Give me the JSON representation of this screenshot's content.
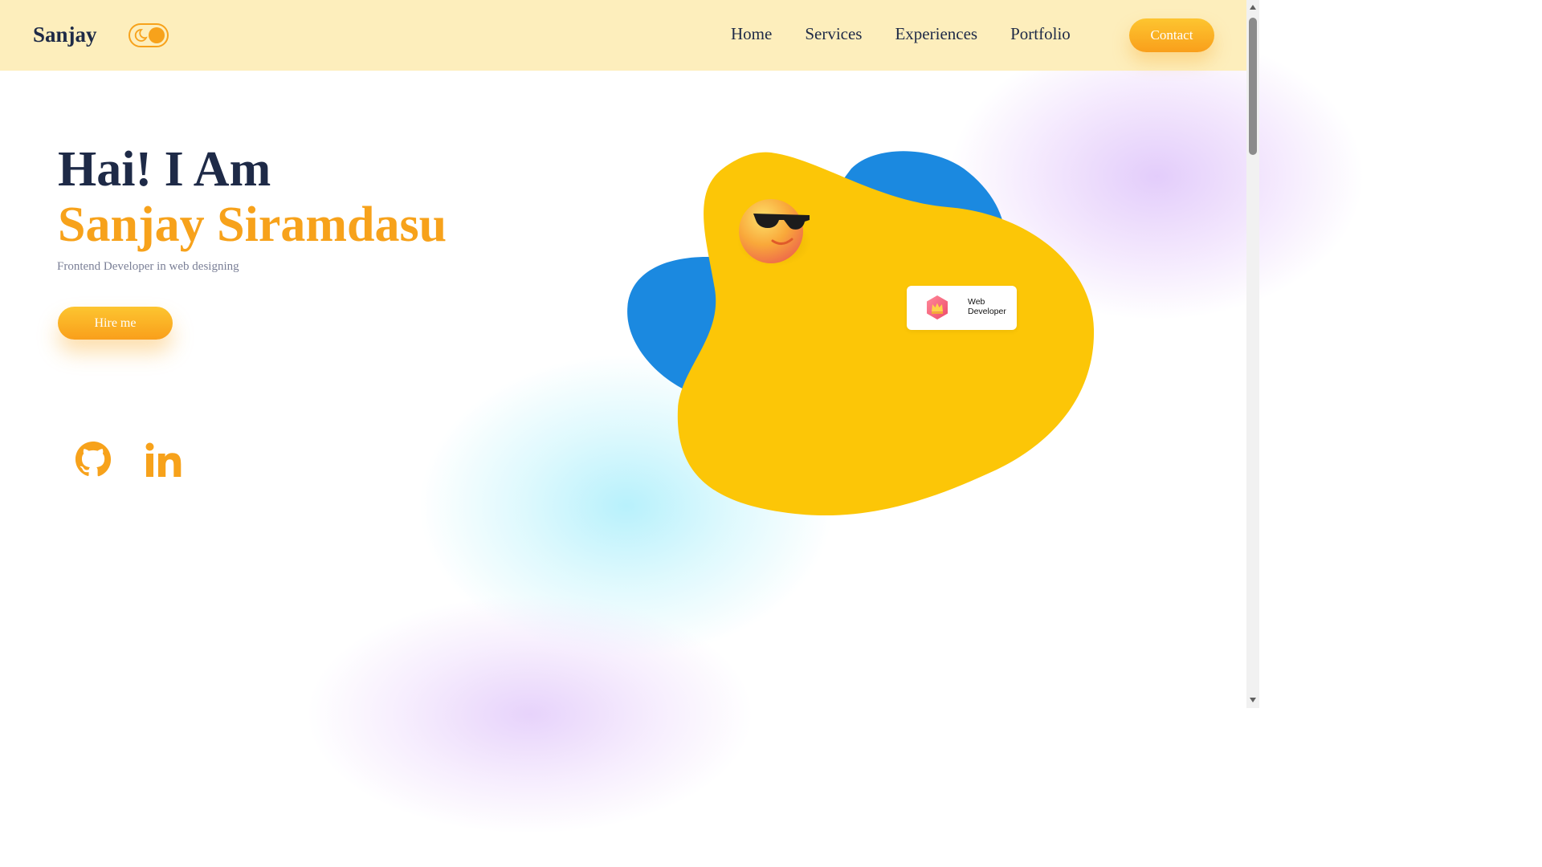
{
  "navbar": {
    "logo": "Sanjay",
    "links": [
      {
        "label": "Home"
      },
      {
        "label": "Services"
      },
      {
        "label": "Experiences"
      },
      {
        "label": "Portfolio"
      }
    ],
    "contact_label": "Contact"
  },
  "hero": {
    "greeting": "Hai! I Am",
    "name": "Sanjay Siramdasu",
    "subtitle": "Frontend Developer in web designing",
    "hire_label": "Hire me"
  },
  "social": {
    "icons": [
      "github-icon",
      "linkedin-icon"
    ]
  },
  "badge": {
    "line1": "Web",
    "line2": "Developer"
  },
  "colors": {
    "accent": "#f7a21b",
    "navbar_bg": "#fdeebc",
    "heading": "#1e2a47",
    "blob_yellow": "#fcc607",
    "blob_blue": "#1b89e0"
  }
}
